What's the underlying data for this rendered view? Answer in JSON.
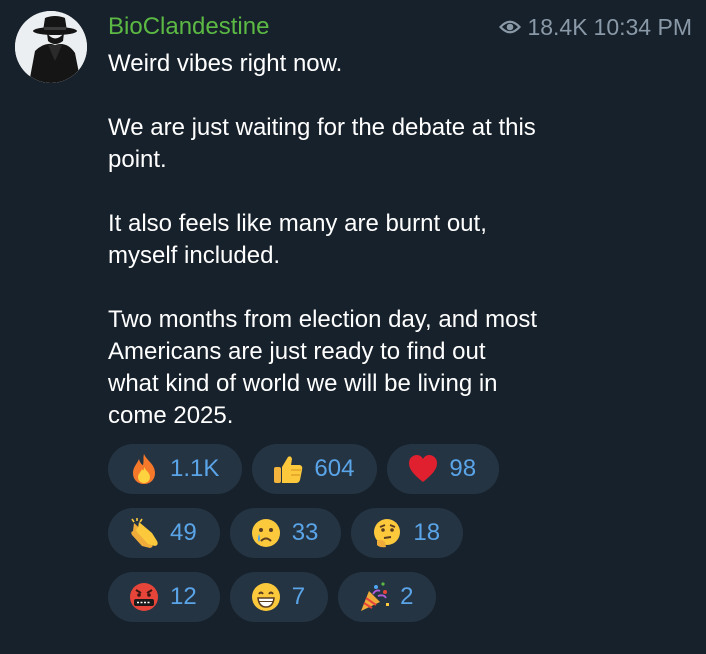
{
  "post": {
    "sender": "BioClandestine",
    "views": "18.4K",
    "time": "10:34 PM",
    "paragraphs": [
      "Weird vibes right now.",
      "We are just waiting for the debate at this point.",
      "It also feels like many are burnt out, myself included.",
      "Two months from election day, and most Americans are just ready to find out what kind of world we will be living in come 2025."
    ]
  },
  "colors": {
    "background": "#17212b",
    "sender": "#5bb944",
    "meta": "#8a99a7",
    "text": "#ffffff",
    "reaction_bg": "#253443",
    "reaction_count": "#5aa4e8"
  },
  "reactions": [
    {
      "emoji": "fire-icon",
      "count": "1.1K"
    },
    {
      "emoji": "thumbs-up-icon",
      "count": "604"
    },
    {
      "emoji": "heart-icon",
      "count": "98"
    },
    {
      "emoji": "clapping-hands-icon",
      "count": "49"
    },
    {
      "emoji": "crying-face-icon",
      "count": "33"
    },
    {
      "emoji": "thinking-face-icon",
      "count": "18"
    },
    {
      "emoji": "cursing-face-icon",
      "count": "12"
    },
    {
      "emoji": "grinning-face-icon",
      "count": "7"
    },
    {
      "emoji": "party-popper-icon",
      "count": "2"
    }
  ]
}
